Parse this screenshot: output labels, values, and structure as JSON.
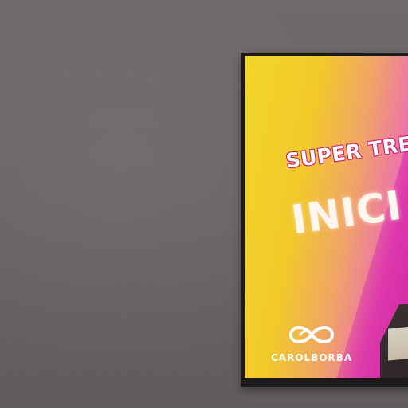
{
  "poster": {
    "headline": "SUPER TRE",
    "big_word": "INICI",
    "logo_text": "CAROLBORBA",
    "logo_icon": "infinity-loop-icon"
  },
  "colors": {
    "wall": "#6b6867",
    "frame": "#1c1a1b",
    "yellow": "#f2d629",
    "pink": "#ec6fb0",
    "magenta": "#d828aa",
    "headline_outline": "#c9217a"
  }
}
